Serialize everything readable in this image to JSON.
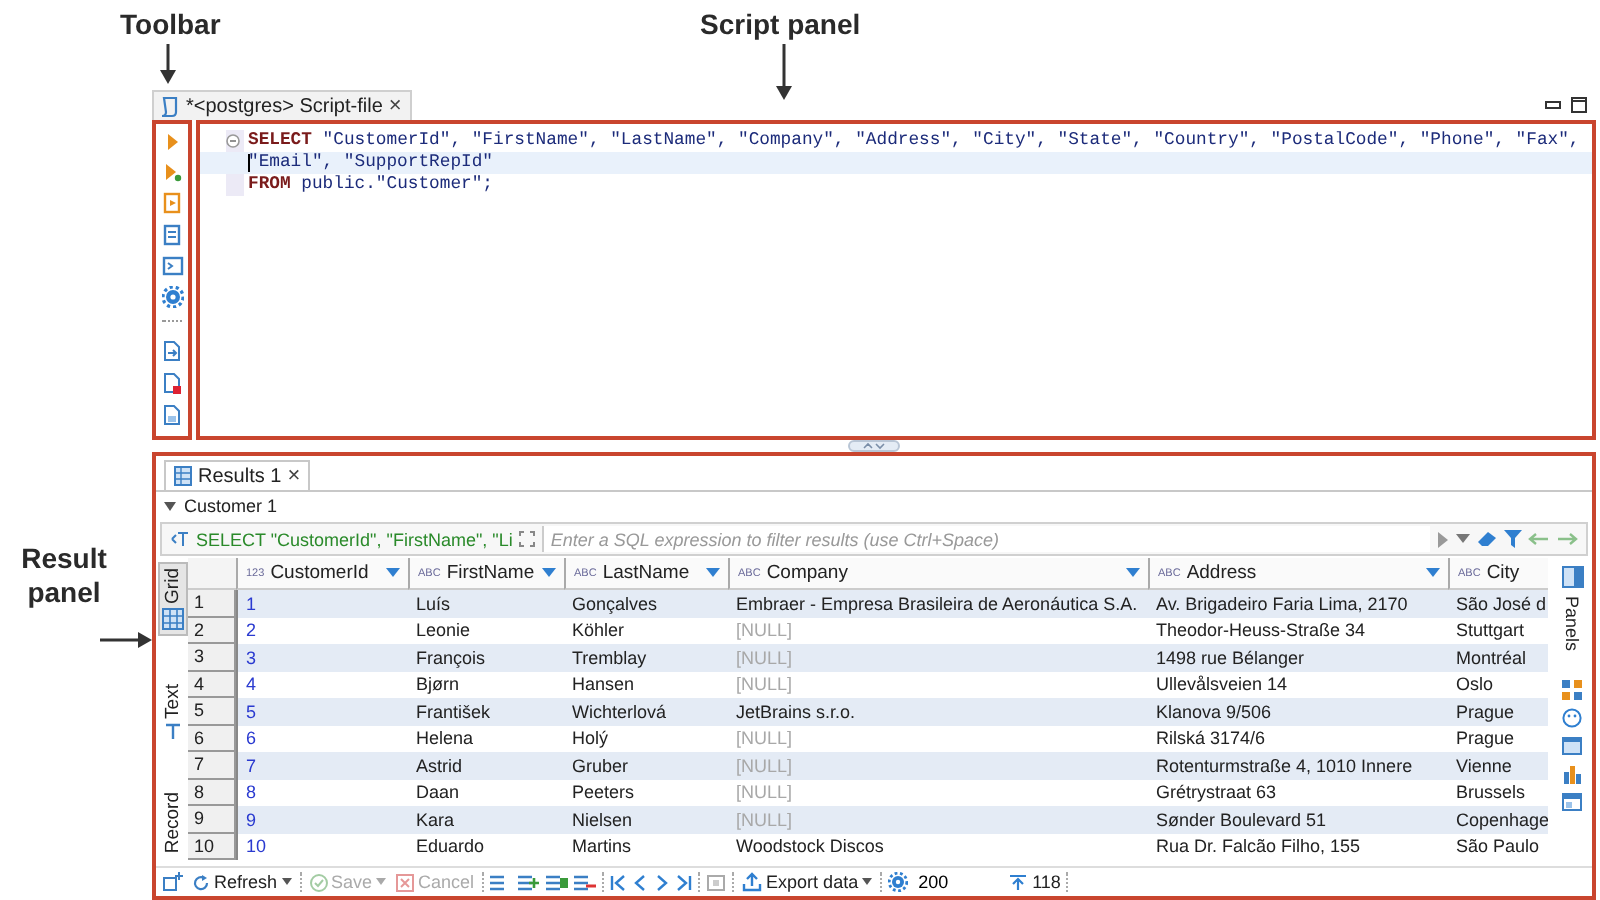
{
  "annotations": [
    {
      "text": "Toolbar"
    },
    {
      "text": "Script panel"
    },
    {
      "text": "Result panel"
    }
  ],
  "editor": {
    "tab": {
      "title": "*<postgres> Script-file",
      "close": "×"
    },
    "lines": [
      {
        "highlighted": false,
        "tokens": [
          {
            "kind": "keyword",
            "text": "SELECT"
          },
          {
            "kind": "ident",
            "text": " \"CustomerId\", \"FirstName\", \"LastName\", \"Company\", \"Address\", \"City\", \"State\", \"Country\", \"PostalCode\", \"Phone\", \"Fax\","
          }
        ]
      },
      {
        "highlighted": true,
        "tokens": [
          {
            "kind": "ident",
            "text": "\"Email\", \"SupportRepId\""
          }
        ]
      },
      {
        "highlighted": false,
        "tokens": [
          {
            "kind": "keyword",
            "text": "FROM"
          },
          {
            "kind": "ident",
            "text": " public.\"Customer\";"
          }
        ]
      }
    ]
  },
  "result": {
    "tab": {
      "label": "Results 1",
      "close": "×"
    },
    "group": "Customer 1",
    "filter": {
      "query": "SELECT \"CustomerId\", \"FirstName\", \"Li",
      "placeholder": "Enter a SQL expression to filter results (use Ctrl+Space)"
    },
    "view_tabs": [
      {
        "label": "Grid",
        "selected": true
      },
      {
        "label": "Text",
        "selected": false
      },
      {
        "label": "Record",
        "selected": false
      }
    ],
    "columns": [
      {
        "type": "123",
        "name": "CustomerId",
        "menu": true
      },
      {
        "type": "ABC",
        "name": "FirstName",
        "menu": true
      },
      {
        "type": "ABC",
        "name": "LastName",
        "menu": true
      },
      {
        "type": "ABC",
        "name": "Company",
        "menu": true
      },
      {
        "type": "ABC",
        "name": "Address",
        "menu": true
      },
      {
        "type": "ABC",
        "name": "City",
        "menu": false
      }
    ],
    "rows": [
      {
        "number": "1",
        "cells": [
          {
            "text": "1",
            "null": false
          },
          {
            "text": "Luís",
            "null": false
          },
          {
            "text": "Gonçalves",
            "null": false
          },
          {
            "text": "Embraer - Empresa Brasileira de Aeronáutica S.A.",
            "null": false
          },
          {
            "text": "Av. Brigadeiro Faria Lima, 2170",
            "null": false
          },
          {
            "text": "São José d",
            "null": false
          }
        ]
      },
      {
        "number": "2",
        "cells": [
          {
            "text": "2",
            "null": false
          },
          {
            "text": "Leonie",
            "null": false
          },
          {
            "text": "Köhler",
            "null": false
          },
          {
            "text": "[NULL]",
            "null": true
          },
          {
            "text": "Theodor-Heuss-Straße 34",
            "null": false
          },
          {
            "text": "Stuttgart",
            "null": false
          }
        ]
      },
      {
        "number": "3",
        "cells": [
          {
            "text": "3",
            "null": false
          },
          {
            "text": "François",
            "null": false
          },
          {
            "text": "Tremblay",
            "null": false
          },
          {
            "text": "[NULL]",
            "null": true
          },
          {
            "text": "1498 rue Bélanger",
            "null": false
          },
          {
            "text": "Montréal",
            "null": false
          }
        ]
      },
      {
        "number": "4",
        "cells": [
          {
            "text": "4",
            "null": false
          },
          {
            "text": "Bjørn",
            "null": false
          },
          {
            "text": "Hansen",
            "null": false
          },
          {
            "text": "[NULL]",
            "null": true
          },
          {
            "text": "Ullevålsveien 14",
            "null": false
          },
          {
            "text": "Oslo",
            "null": false
          }
        ]
      },
      {
        "number": "5",
        "cells": [
          {
            "text": "5",
            "null": false
          },
          {
            "text": "František",
            "null": false
          },
          {
            "text": "Wichterlová",
            "null": false
          },
          {
            "text": "JetBrains s.r.o.",
            "null": false
          },
          {
            "text": "Klanova 9/506",
            "null": false
          },
          {
            "text": "Prague",
            "null": false
          }
        ]
      },
      {
        "number": "6",
        "cells": [
          {
            "text": "6",
            "null": false
          },
          {
            "text": "Helena",
            "null": false
          },
          {
            "text": "Holý",
            "null": false
          },
          {
            "text": "[NULL]",
            "null": true
          },
          {
            "text": "Rilská 3174/6",
            "null": false
          },
          {
            "text": "Prague",
            "null": false
          }
        ]
      },
      {
        "number": "7",
        "cells": [
          {
            "text": "7",
            "null": false
          },
          {
            "text": "Astrid",
            "null": false
          },
          {
            "text": "Gruber",
            "null": false
          },
          {
            "text": "[NULL]",
            "null": true
          },
          {
            "text": "Rotenturmstraße 4, 1010 Innere",
            "null": false
          },
          {
            "text": "Vienne",
            "null": false
          }
        ]
      },
      {
        "number": "8",
        "cells": [
          {
            "text": "8",
            "null": false
          },
          {
            "text": "Daan",
            "null": false
          },
          {
            "text": "Peeters",
            "null": false
          },
          {
            "text": "[NULL]",
            "null": true
          },
          {
            "text": "Grétrystraat 63",
            "null": false
          },
          {
            "text": "Brussels",
            "null": false
          }
        ]
      },
      {
        "number": "9",
        "cells": [
          {
            "text": "9",
            "null": false
          },
          {
            "text": "Kara",
            "null": false
          },
          {
            "text": "Nielsen",
            "null": false
          },
          {
            "text": "[NULL]",
            "null": true
          },
          {
            "text": "Sønder Boulevard 51",
            "null": false
          },
          {
            "text": "Copenhage",
            "null": false
          }
        ]
      },
      {
        "number": "10",
        "cells": [
          {
            "text": "10",
            "null": false
          },
          {
            "text": "Eduardo",
            "null": false
          },
          {
            "text": "Martins",
            "null": false
          },
          {
            "text": "Woodstock Discos",
            "null": false
          },
          {
            "text": "Rua Dr. Falcão Filho, 155",
            "null": false
          },
          {
            "text": "São Paulo",
            "null": false
          }
        ]
      }
    ],
    "side_panel": {
      "label": "Panels"
    },
    "toolbar": {
      "buttons": [
        {
          "label": "Refresh",
          "disabled": false
        },
        {
          "label": "Save",
          "disabled": true
        },
        {
          "label": "Cancel",
          "disabled": true
        },
        {
          "label": "Export data",
          "disabled": false
        }
      ],
      "fetch_size": "200",
      "row_count": "118"
    }
  }
}
